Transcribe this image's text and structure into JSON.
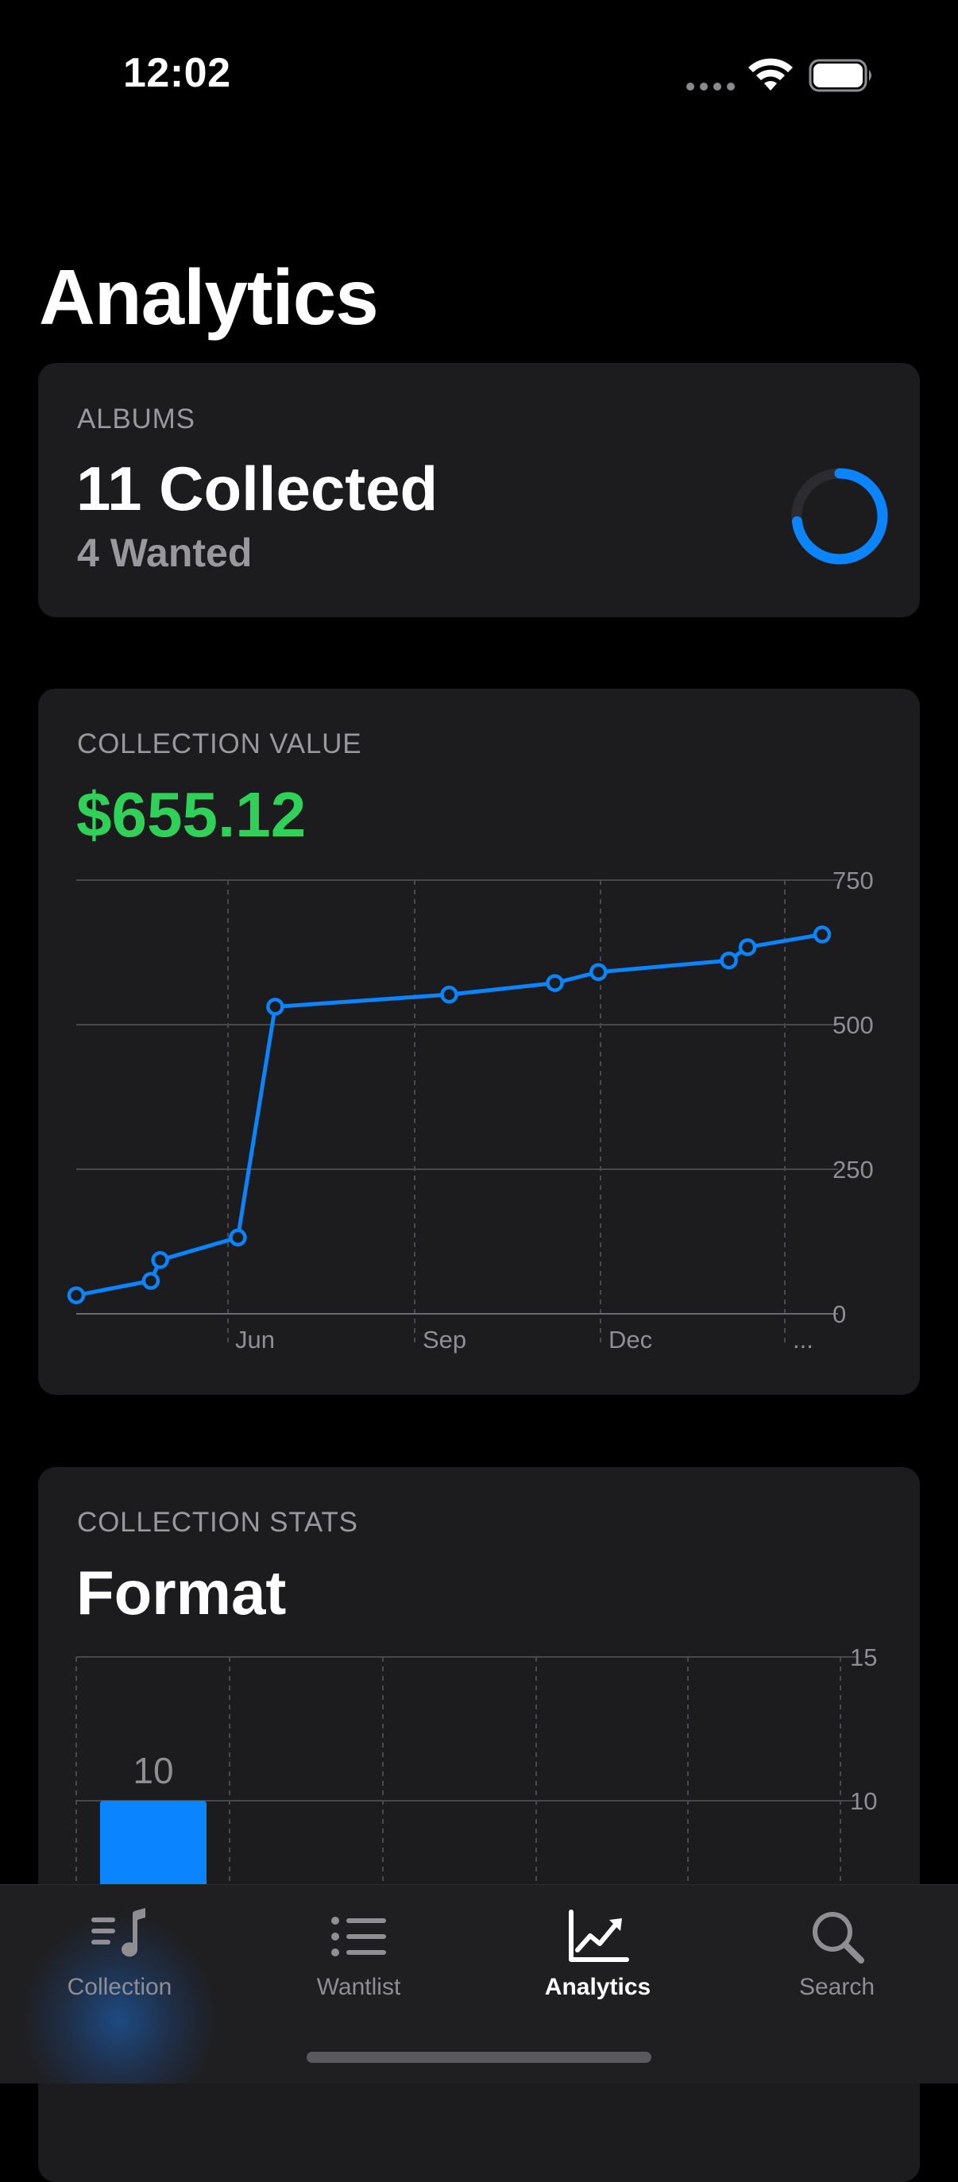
{
  "status_bar": {
    "time": "12:02",
    "icons": [
      "signal-dots-icon",
      "wifi-icon",
      "battery-icon"
    ]
  },
  "page": {
    "title": "Analytics"
  },
  "albums_card": {
    "label": "ALBUMS",
    "collected": "11 Collected",
    "wanted": "4 Wanted",
    "progress_fraction": 0.73,
    "ring_color": "#0a84ff"
  },
  "value_card": {
    "label": "COLLECTION VALUE",
    "amount": "$655.12",
    "amount_color": "#30d158"
  },
  "stats_card": {
    "label": "COLLECTION STATS",
    "heading": "Format"
  },
  "chart_data": [
    {
      "type": "line",
      "title": "",
      "color": "#0a84ff",
      "x_tick_labels": [
        "Jun",
        "Sep",
        "Dec",
        "..."
      ],
      "y_tick_labels": [
        "750",
        "500",
        "250",
        "0"
      ],
      "ylim": [
        0,
        750
      ],
      "grid": true,
      "x": [
        0,
        1.2,
        1.35,
        2.6,
        3.2,
        6.0,
        7.7,
        8.4,
        10.5,
        10.8,
        12.0
      ],
      "values": [
        32,
        57,
        93,
        132,
        531,
        552,
        572,
        591,
        611,
        634,
        656
      ]
    },
    {
      "type": "bar",
      "title": "Format",
      "color": "#0a84ff",
      "y_tick_labels": [
        "15",
        "10"
      ],
      "ylim": [
        0,
        15
      ],
      "grid": true,
      "categories": [
        ""
      ],
      "values": [
        10
      ],
      "data_labels": [
        "10"
      ]
    }
  ],
  "tab_bar": {
    "tabs": [
      {
        "label": "Collection",
        "icon": "music-list-icon",
        "active": false
      },
      {
        "label": "Wantlist",
        "icon": "list-icon",
        "active": false
      },
      {
        "label": "Analytics",
        "icon": "trend-chart-icon",
        "active": true
      },
      {
        "label": "Search",
        "icon": "search-icon",
        "active": false
      }
    ]
  }
}
